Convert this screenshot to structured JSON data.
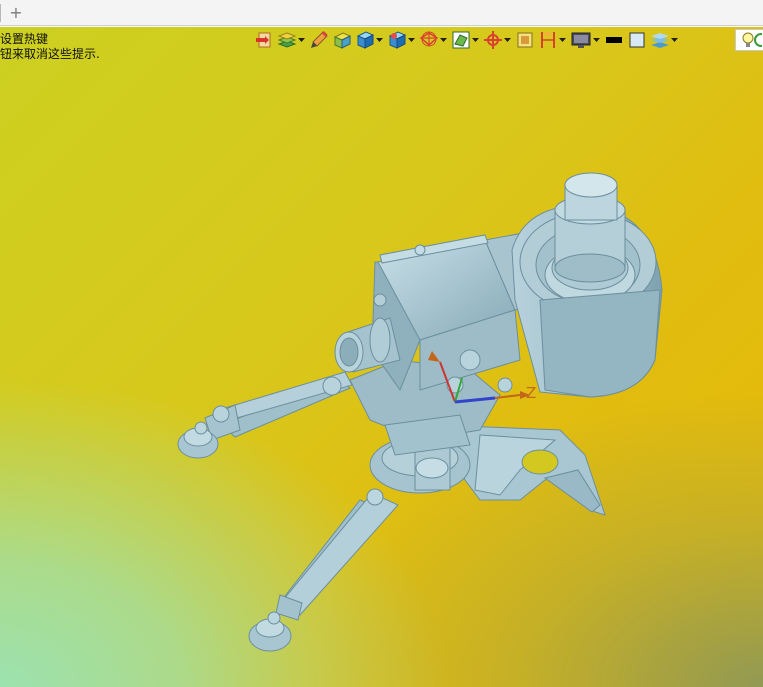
{
  "tabstrip": {
    "new_tab_label": "+"
  },
  "viewport": {
    "hint_line1": "设置热键",
    "hint_line2": "钮来取消这些提示.",
    "triad_z_label": "Z"
  },
  "toolbar": {
    "items": [
      {
        "icon": "view-manager-icon"
      },
      {
        "icon": "layers-icon",
        "dropdown": true
      },
      {
        "icon": "annotation-pen-icon"
      },
      {
        "icon": "shade-box-icon"
      },
      {
        "icon": "display-style-icon",
        "dropdown": true
      },
      {
        "icon": "perspective-icon",
        "dropdown": true
      },
      {
        "icon": "datum-display-icon",
        "dropdown": true
      },
      {
        "icon": "section-view-icon",
        "dropdown": true
      },
      {
        "icon": "spin-center-icon",
        "dropdown": true
      },
      {
        "icon": "saved-views-icon"
      },
      {
        "icon": "repaint-icon",
        "dropdown": true
      },
      {
        "icon": "display-settings-icon",
        "dropdown": true
      },
      {
        "icon": "black-swatch-icon"
      },
      {
        "icon": "white-swatch-icon"
      },
      {
        "icon": "appearance-gallery-icon",
        "dropdown": true
      },
      {
        "icon": "lightbulb-icon"
      }
    ]
  },
  "colors": {
    "model_fill": "#9fc0cc",
    "model_light": "#c9e0e8",
    "model_dark": "#6b8f9e",
    "axis_x": "#cc3333",
    "axis_y": "#33aa33",
    "axis_z": "#3344cc",
    "triad_label": "#c4661a"
  }
}
